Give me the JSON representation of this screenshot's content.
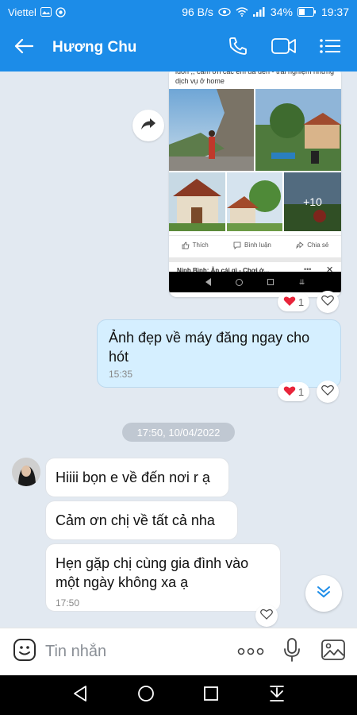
{
  "status_bar": {
    "carrier": "Viettel",
    "net_speed": "96 B/s",
    "battery": "34%",
    "time": "19:37"
  },
  "header": {
    "contact_name": "Hương Chu",
    "icons": [
      "back-arrow-icon",
      "phone-icon",
      "video-call-icon",
      "menu-list-icon"
    ],
    "background": "#1c8ce8"
  },
  "shared_post": {
    "caption": "luôn ,, cảm ơn các em đã đến - trải nghiệm những dịch vụ ở home",
    "more_photos": "+10",
    "actions": {
      "like": "Thích",
      "comment": "Bình luận",
      "share": "Chia sẻ"
    },
    "next_post_title": "Ninh Bình: Ăn cái gì - Chơi ở..."
  },
  "reactions": [
    {
      "emoji": "heart",
      "count": "1"
    },
    {
      "emoji": "heart",
      "count": "1"
    }
  ],
  "messages": {
    "outgoing_1": {
      "text": "Ảnh đẹp về máy đăng ngay cho hót",
      "time": "15:35"
    },
    "date_separator": "17:50, 10/04/2022",
    "incoming_1": {
      "text": "Hiiii bọn e về đến nơi r ạ"
    },
    "incoming_2": {
      "text": "Cảm ơn chị về tất cả nha"
    },
    "incoming_3": {
      "text": "Hẹn gặp chị cùng gia đình vào một ngày không xa ạ",
      "time": "17:50"
    }
  },
  "input_bar": {
    "placeholder": "Tin nhắn",
    "more_label": "ooo"
  },
  "colors": {
    "accent": "#1c8ce8",
    "chat_background": "#e2e9f1",
    "outgoing_bubble": "#d5efff",
    "heart": "#e8243a"
  }
}
